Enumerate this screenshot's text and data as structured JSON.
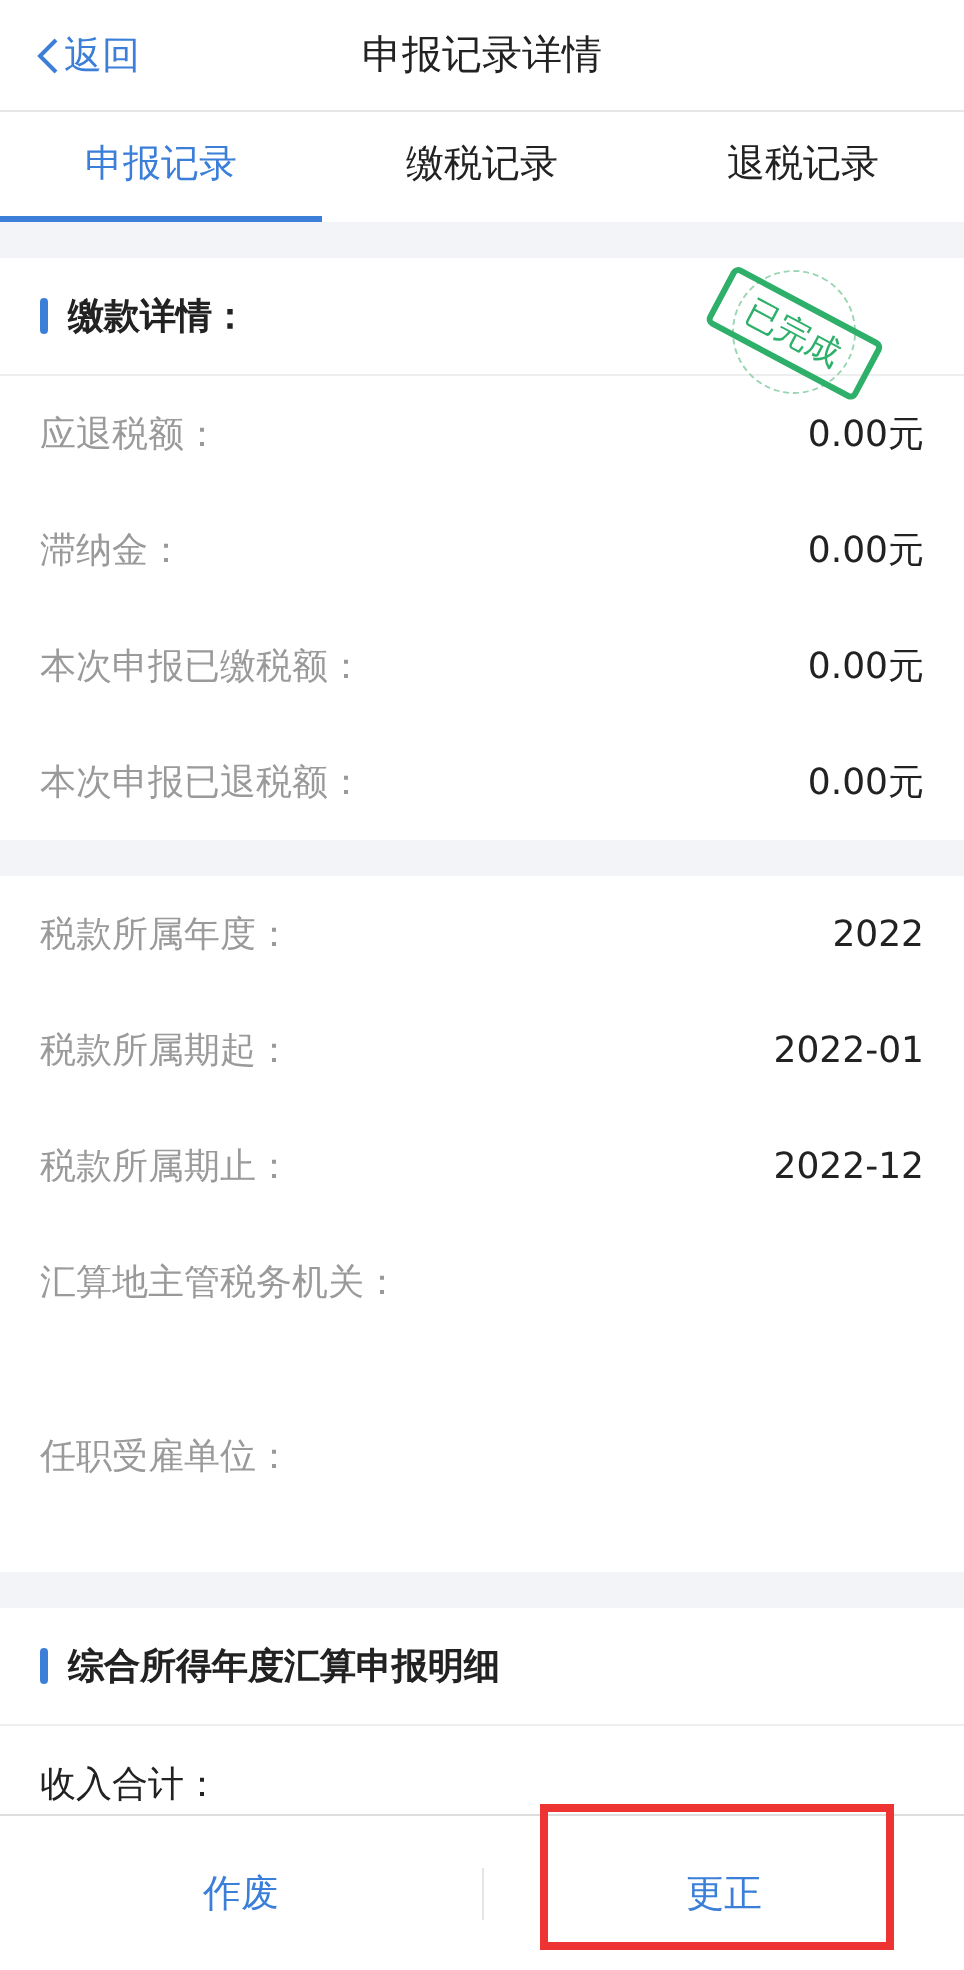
{
  "header": {
    "back": "返回",
    "title": "申报记录详情"
  },
  "tabs": [
    {
      "label": "申报记录",
      "selected": true
    },
    {
      "label": "缴税记录",
      "selected": false
    },
    {
      "label": "退税记录",
      "selected": false
    }
  ],
  "sections": [
    {
      "title": "缴款详情：",
      "stamp": "已完成",
      "rows": [
        {
          "label": "应退税额：",
          "value": "0.00元"
        },
        {
          "label": "滞纳金：",
          "value": "0.00元"
        },
        {
          "label": "本次申报已缴税额：",
          "value": "0.00元"
        },
        {
          "label": "本次申报已退税额：",
          "value": "0.00元"
        }
      ]
    },
    {
      "rows": [
        {
          "label": "税款所属年度：",
          "value": "2022"
        },
        {
          "label": "税款所属期起：",
          "value": "2022-01"
        },
        {
          "label": "税款所属期止：",
          "value": "2022-12"
        },
        {
          "label": "汇算地主管税务机关："
        },
        {
          "label": "任职受雇单位："
        }
      ]
    },
    {
      "title": "综合所得年度汇算申报明细",
      "rows": [
        {
          "label": "收入合计：",
          "kind": "dark"
        }
      ]
    }
  ],
  "actions": [
    {
      "label": "作废",
      "highlighted": false
    },
    {
      "label": "更正",
      "highlighted": true
    }
  ]
}
